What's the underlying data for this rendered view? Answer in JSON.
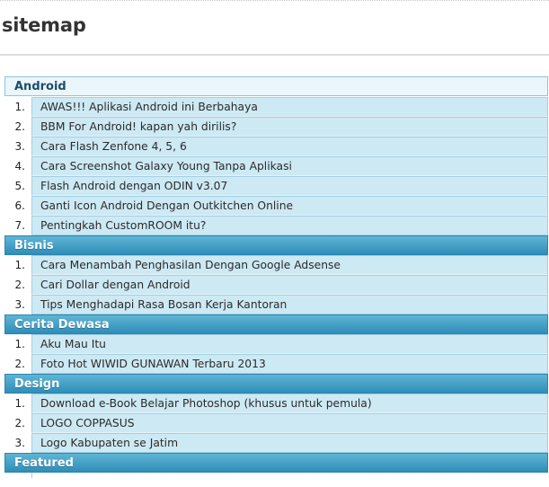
{
  "page": {
    "title": "sitemap"
  },
  "categories": [
    {
      "name": "Android",
      "posts": [
        {
          "num": "1.",
          "title": "AWAS!!! Aplikasi Android ini Berbahaya"
        },
        {
          "num": "2.",
          "title": "BBM For Android! kapan yah dirilis?"
        },
        {
          "num": "3.",
          "title": "Cara Flash Zenfone 4, 5, 6"
        },
        {
          "num": "4.",
          "title": "Cara Screenshot Galaxy Young Tanpa Aplikasi"
        },
        {
          "num": "5.",
          "title": "Flash Android dengan ODIN v3.07"
        },
        {
          "num": "6.",
          "title": "Ganti Icon Android Dengan Outkitchen Online"
        },
        {
          "num": "7.",
          "title": "Pentingkah CustomROOM itu?"
        }
      ]
    },
    {
      "name": "Bisnis",
      "posts": [
        {
          "num": "1.",
          "title": "Cara Menambah Penghasilan Dengan Google Adsense"
        },
        {
          "num": "2.",
          "title": "Cari Dollar dengan Android"
        },
        {
          "num": "3.",
          "title": "Tips Menghadapi Rasa Bosan Kerja Kantoran"
        }
      ]
    },
    {
      "name": "Cerita Dewasa",
      "posts": [
        {
          "num": "1.",
          "title": "Aku Mau Itu"
        },
        {
          "num": "2.",
          "title": "Foto Hot WIWID GUNAWAN Terbaru 2013"
        }
      ]
    },
    {
      "name": "Design",
      "posts": [
        {
          "num": "1.",
          "title": "Download e-Book Belajar Photoshop (khusus untuk pemula)"
        },
        {
          "num": "2.",
          "title": "LOGO COPPASUS"
        },
        {
          "num": "3.",
          "title": "Logo Kabupaten se Jatim"
        }
      ]
    },
    {
      "name": "Featured",
      "posts": []
    }
  ]
}
